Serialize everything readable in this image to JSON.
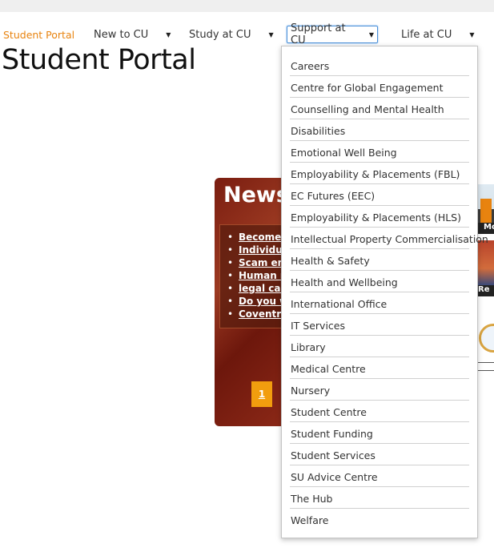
{
  "nav": {
    "home": "Student Portal",
    "items": [
      {
        "label": "New to CU",
        "arrow": "▼"
      },
      {
        "label": "Study at CU",
        "arrow": "▼"
      },
      {
        "label": "Support at CU",
        "arrow": "▼"
      },
      {
        "label": "Life at CU",
        "arrow": "▼"
      }
    ]
  },
  "page": {
    "title": "Student Portal"
  },
  "news": {
    "title": "News",
    "items": [
      "Become a",
      "Individua",
      "Scam em",
      "Human ri",
      "legal case",
      "Do you w",
      "Coventry"
    ],
    "page": "1"
  },
  "side": {
    "thumb1_label": "Mo",
    "thumb2_label": "Re"
  },
  "dropdown": {
    "items": [
      "Careers",
      "Centre for Global Engagement",
      "Counselling and Mental Health",
      "Disabilities",
      "Emotional Well Being",
      "Employability & Placements (FBL)",
      "EC Futures (EEC)",
      "Employability & Placements (HLS)",
      "Intellectual Property Commercialisation",
      "Health & Safety",
      "Health and Wellbeing",
      "International Office",
      "IT Services",
      "Library",
      "Medical Centre",
      "Nursery",
      "Student Centre",
      "Student Funding",
      "Student Services",
      "SU Advice Centre",
      "The Hub",
      "Welfare"
    ]
  },
  "colors": {
    "accent": "#e8830f",
    "news_bg": "#7a1d10",
    "pager": "#f29d0e",
    "focus": "#4a90d9"
  }
}
